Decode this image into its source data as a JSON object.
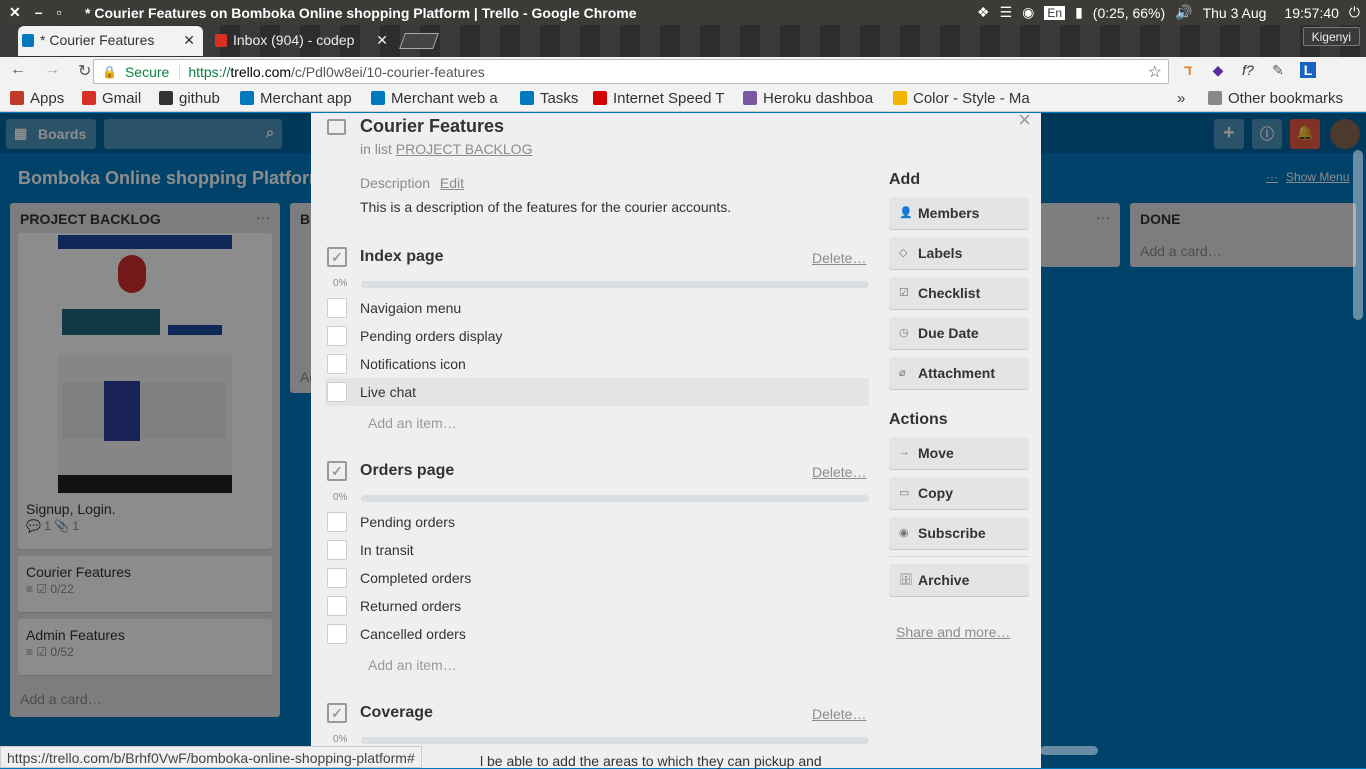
{
  "window": {
    "title": "* Courier Features on Bomboka Online shopping Platform | Trello - Google Chrome",
    "controls": [
      "✕",
      "–",
      "▫"
    ],
    "tray": {
      "battery": "(0:25, 66%)",
      "lang": "En",
      "day": "Thu 3 Aug",
      "time": "19:57:40"
    },
    "user": "Kigenyi"
  },
  "tabs": [
    {
      "label": "* Courier Features",
      "close": "✕",
      "active": true
    },
    {
      "label": "Inbox (904) - codep",
      "close": "✕",
      "active": false
    }
  ],
  "address": {
    "secure": "Secure",
    "scheme": "https://",
    "host": "trello.com",
    "path": "/c/Pdl0w8ei/10-courier-features"
  },
  "bookmarks": {
    "items": [
      {
        "label": "Apps",
        "color": "#c0392b"
      },
      {
        "label": "Gmail",
        "color": "#d93025"
      },
      {
        "label": "github",
        "color": "#333333"
      },
      {
        "label": "Merchant app",
        "color": "#0079bf"
      },
      {
        "label": "Merchant web a",
        "color": "#0079bf"
      },
      {
        "label": "Tasks",
        "color": "#0079bf"
      },
      {
        "label": "Internet Speed T",
        "color": "#d50000"
      },
      {
        "label": "Heroku dashboa",
        "color": "#79589f"
      },
      {
        "label": "Color - Style - Ma",
        "color": "#f4b400"
      }
    ],
    "overflow": "»",
    "other": "Other bookmarks"
  },
  "trello": {
    "boards_button": "Boards",
    "board_title": "Bomboka Online shopping Platform",
    "show_menu": "Show Menu",
    "menu_dots": "···"
  },
  "lists": {
    "backlog": {
      "title": "PROJECT BACKLOG",
      "dots": "···",
      "cards": [
        {
          "title": "Signup, Login.",
          "badges": "💬 1   📎 1"
        },
        {
          "title": "Courier Features",
          "badges": "≡   ☑ 0/22"
        },
        {
          "title": "Admin Features",
          "badges": "≡   ☑ 0/52"
        }
      ],
      "add": "Add a card…"
    },
    "second": {
      "title": "B",
      "partial": "Ad"
    },
    "done": {
      "title": "DONE",
      "add": "Add a card…"
    }
  },
  "modal": {
    "title": "Courier Features",
    "in_list_prefix": "in list",
    "list_name": "PROJECT BACKLOG",
    "description_label": "Description",
    "edit": "Edit",
    "description": "This is a description of the features for the courier accounts.",
    "checklists": [
      {
        "title": "Index page",
        "delete": "Delete…",
        "percent": "0%",
        "items": [
          "Navigaion menu",
          "Pending orders display",
          "Notifications icon",
          "Live chat"
        ],
        "add": "Add an item…"
      },
      {
        "title": "Orders page",
        "delete": "Delete…",
        "percent": "0%",
        "items": [
          "Pending orders",
          "In transit",
          "Completed orders",
          "Returned orders",
          "Cancelled orders"
        ],
        "add": "Add an item…"
      },
      {
        "title": "Coverage",
        "delete": "Delete…",
        "percent": "0%"
      }
    ],
    "coverage_text": "l be able to add the areas to which they can pickup and",
    "sidebar": {
      "add_heading": "Add",
      "add_buttons": [
        "Members",
        "Labels",
        "Checklist",
        "Due Date",
        "Attachment"
      ],
      "actions_heading": "Actions",
      "action_buttons": [
        "Move",
        "Copy",
        "Subscribe"
      ],
      "archive": "Archive",
      "share": "Share and more…"
    }
  },
  "status_url": "https://trello.com/b/Brhf0VwF/bomboka-online-shopping-platform#"
}
